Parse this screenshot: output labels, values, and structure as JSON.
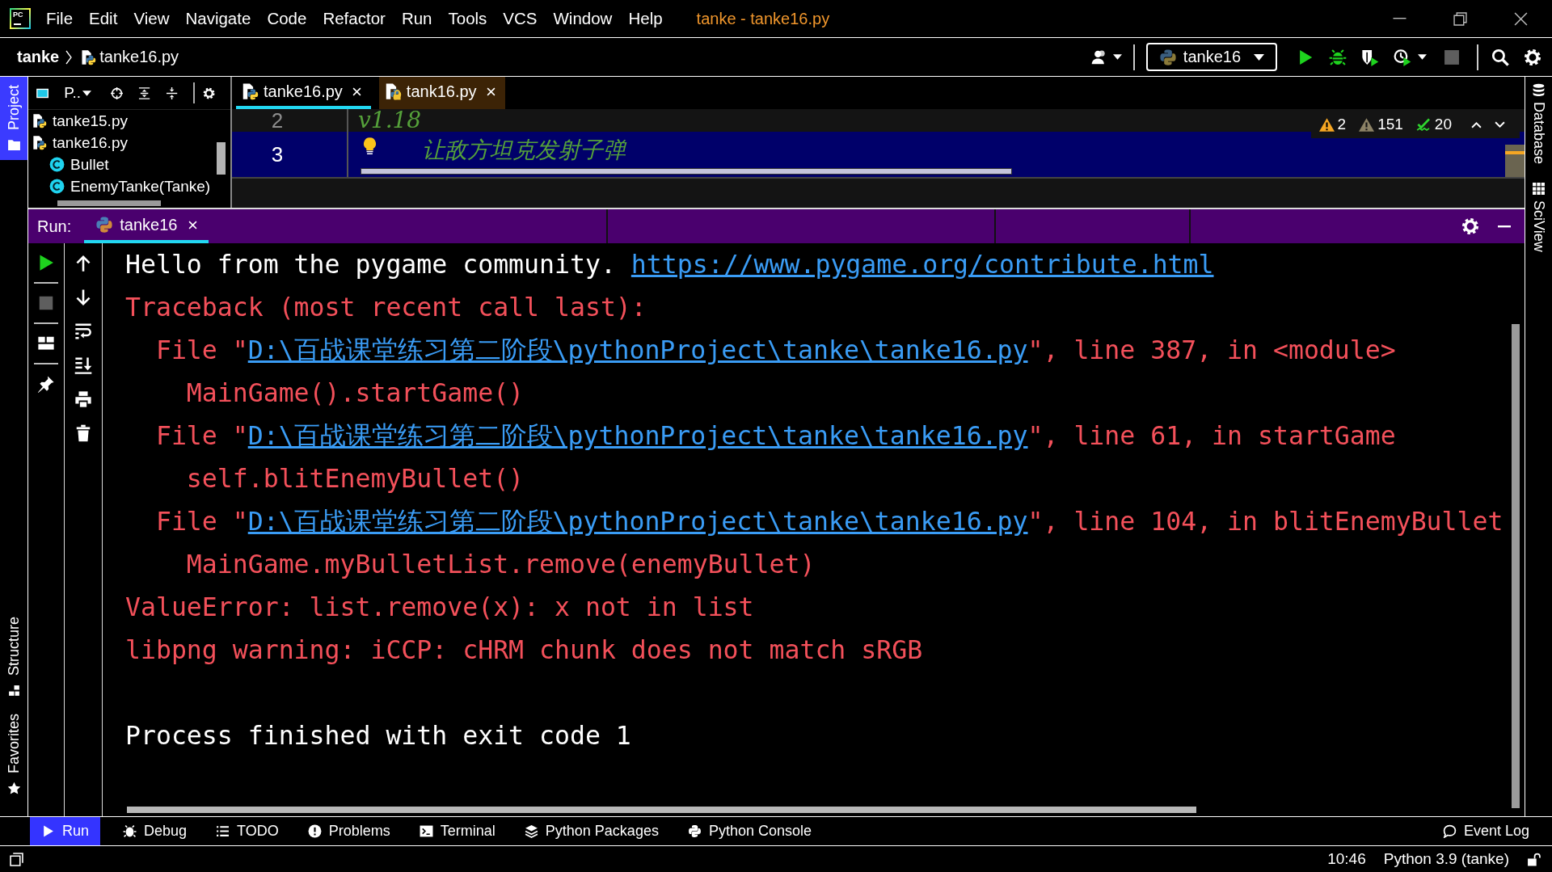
{
  "app_logo": {
    "text": "PC"
  },
  "menu": [
    "File",
    "Edit",
    "View",
    "Navigate",
    "Code",
    "Refactor",
    "Run",
    "Tools",
    "VCS",
    "Window",
    "Help"
  ],
  "window": {
    "title": "tanke - tanke16.py"
  },
  "breadcrumb": [
    {
      "label": "tanke",
      "kind": "project"
    },
    {
      "label": "tanke16.py",
      "kind": "python_file"
    }
  ],
  "run_config": {
    "label": "tanke16"
  },
  "left_stripe": {
    "top": [
      {
        "label": "Project",
        "kind": "project",
        "selected": true
      }
    ],
    "bottom": [
      {
        "label": "Structure",
        "kind": "structure",
        "selected": false
      },
      {
        "label": "Favorites",
        "kind": "favorites",
        "selected": false
      }
    ]
  },
  "right_stripe": [
    {
      "label": "Database",
      "kind": "database",
      "selected": false
    },
    {
      "label": "SciView",
      "kind": "sciview",
      "selected": false
    }
  ],
  "project_panel": {
    "view_label": "P..",
    "tree": [
      {
        "label": "tanke15.py",
        "kind": "python_file"
      },
      {
        "label": "tanke16.py",
        "kind": "python_file",
        "children": [
          {
            "label": "Bullet",
            "kind": "class"
          },
          {
            "label": "EnemyTanke(Tanke)",
            "kind": "class"
          }
        ]
      }
    ]
  },
  "editor": {
    "tabs": [
      {
        "label": "tanke16.py",
        "selected": true,
        "locked": false,
        "non_project": false
      },
      {
        "label": "tank16.py",
        "selected": false,
        "locked": true,
        "non_project": true
      }
    ],
    "lines": [
      {
        "number": "2",
        "text": "v1.18",
        "current": false,
        "bulb": false
      },
      {
        "number": "3",
        "text": "让敌方坦克发射子弹",
        "current": true,
        "bulb": true
      }
    ],
    "inspections": {
      "warnings": "2",
      "weak_warnings": "151",
      "checks": "20"
    }
  },
  "run_panel": {
    "label": "Run:",
    "tabs": [
      {
        "label": "tanke16",
        "selected": true
      }
    ],
    "console": {
      "lines": [
        {
          "kind": "stdout",
          "text": "Hello from the pygame community. ",
          "link": "https://www.pygame.org/contribute.html"
        },
        {
          "kind": "stderr",
          "text": "Traceback (most recent call last):",
          "children": [
            {
              "kind": "stderr",
              "text": "File \"",
              "link": "D:\\百战课堂练习第二阶段\\pythonProject\\tanke\\tanke16.py",
              "after": "\", line 387, in <module>",
              "children": [
                {
                  "kind": "stderr",
                  "text": "MainGame().startGame()"
                }
              ]
            },
            {
              "kind": "stderr",
              "text": "File \"",
              "link": "D:\\百战课堂练习第二阶段\\pythonProject\\tanke\\tanke16.py",
              "after": "\", line 61, in startGame",
              "children": [
                {
                  "kind": "stderr",
                  "text": "self.blitEnemyBullet()"
                }
              ]
            },
            {
              "kind": "stderr",
              "text": "File \"",
              "link": "D:\\百战课堂练习第二阶段\\pythonProject\\tanke\\tanke16.py",
              "after": "\", line 104, in blitEnemyBullet",
              "children": [
                {
                  "kind": "stderr",
                  "text": "MainGame.myBulletList.remove(enemyBullet)"
                }
              ]
            }
          ]
        },
        {
          "kind": "stderr",
          "text": "ValueError: list.remove(x): x not in list"
        },
        {
          "kind": "stderr",
          "text": "libpng warning: iCCP: cHRM chunk does not match sRGB"
        },
        {
          "kind": "blank"
        },
        {
          "kind": "system",
          "text": "Process finished with exit code 1"
        }
      ]
    }
  },
  "tool_windows": {
    "items": [
      {
        "label": "Run",
        "kind": "run",
        "selected": true
      },
      {
        "label": "Debug",
        "kind": "debug",
        "selected": false
      },
      {
        "label": "TODO",
        "kind": "todo",
        "selected": false
      },
      {
        "label": "Problems",
        "kind": "problems",
        "selected": false
      },
      {
        "label": "Terminal",
        "kind": "terminal",
        "selected": false
      },
      {
        "label": "Python Packages",
        "kind": "packages",
        "selected": false
      },
      {
        "label": "Python Console",
        "kind": "python_console",
        "selected": false
      }
    ],
    "event_log": {
      "label": "Event Log"
    }
  },
  "status_bar": {
    "cursor_position": "10:46",
    "interpreter": "Python 3.9 (tanke)"
  }
}
